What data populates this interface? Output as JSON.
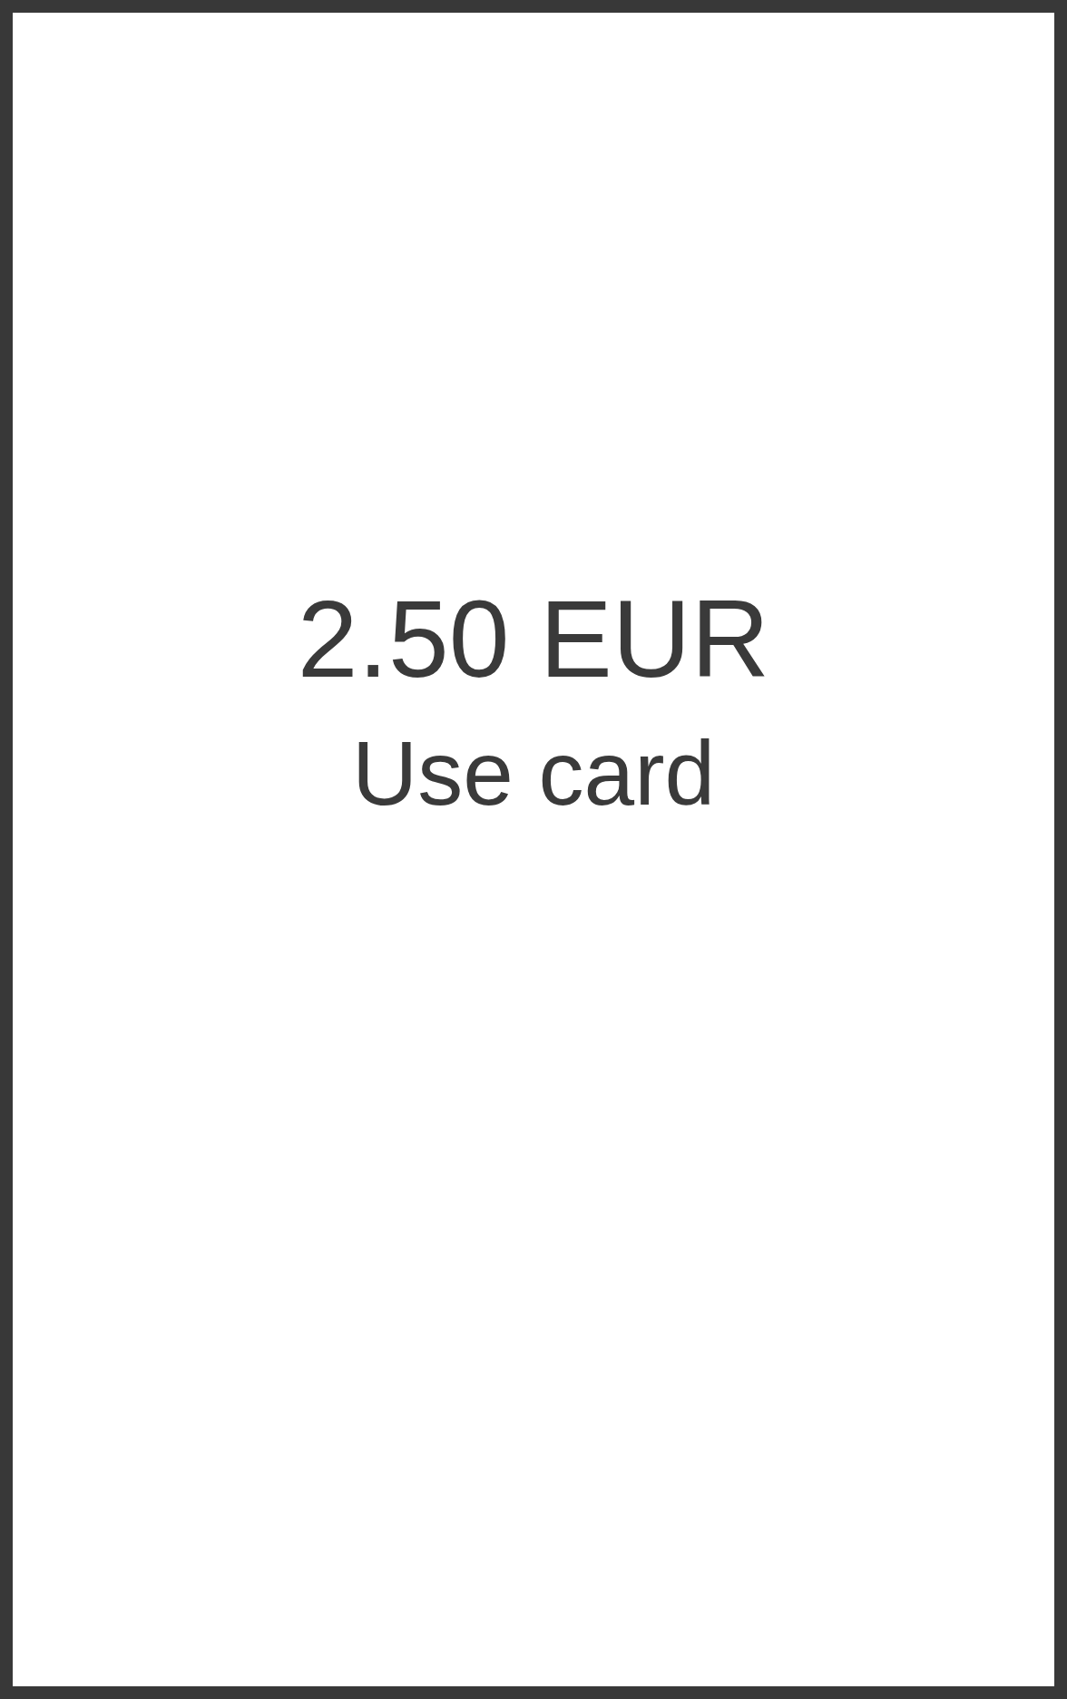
{
  "amount": "2.50 EUR",
  "action": "Use card"
}
